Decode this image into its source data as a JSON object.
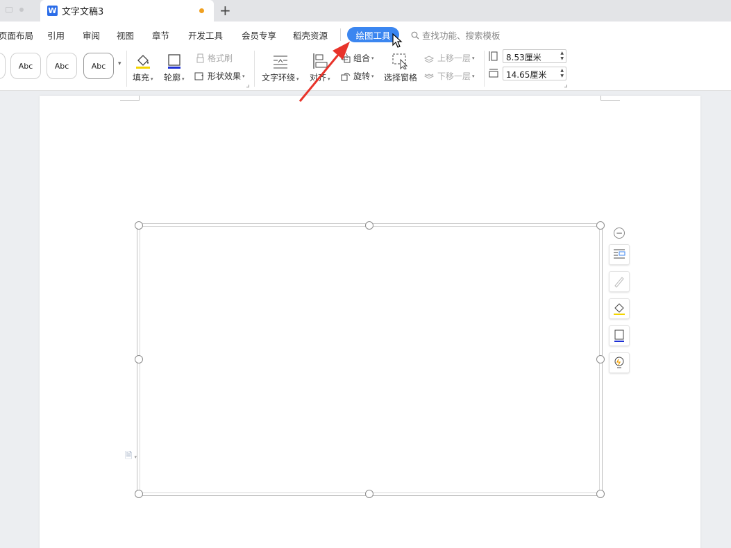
{
  "tabs": {
    "document_title": "文字文稿3",
    "new_tab_label": "+"
  },
  "menu": {
    "items": [
      "页面布局",
      "引用",
      "审阅",
      "视图",
      "章节",
      "开发工具",
      "会员专享",
      "稻壳资源"
    ],
    "active_tab": "绘图工具",
    "search_text": "查找功能、搜索模板"
  },
  "ribbon": {
    "style_samples": [
      "Abc",
      "Abc",
      "Abc"
    ],
    "fill_label": "填充",
    "outline_label": "轮廓",
    "format_painter_label": "格式刷",
    "shape_effects_label": "形状效果",
    "text_wrap_label": "文字环绕",
    "align_label": "对齐",
    "group_label": "组合",
    "rotate_label": "旋转",
    "selection_pane_label": "选择窗格",
    "bring_forward_label": "上移一层",
    "send_backward_label": "下移一层",
    "height_value": "8.53厘米",
    "width_value": "14.65厘米"
  },
  "colors": {
    "accent": "#3b86f0",
    "arrow": "#e8332a",
    "unsaved_dot": "#f0a020",
    "fill_yellow": "#f3d400",
    "outline_blue": "#1c2fd4"
  },
  "icons": [
    "search-icon",
    "fill-icon",
    "outline-icon",
    "format-painter-icon",
    "shape-effects-icon",
    "text-wrap-icon",
    "align-icon",
    "group-icon",
    "rotate-icon",
    "selection-pane-icon",
    "bring-forward-icon",
    "send-backward-icon",
    "height-icon",
    "width-icon",
    "collapse-icon",
    "layout-options-icon",
    "pen-icon",
    "paint-bucket-icon",
    "frame-icon",
    "lightbulb-icon",
    "paragraph-icon",
    "pointer-cursor-icon",
    "red-arrow-annotation"
  ]
}
